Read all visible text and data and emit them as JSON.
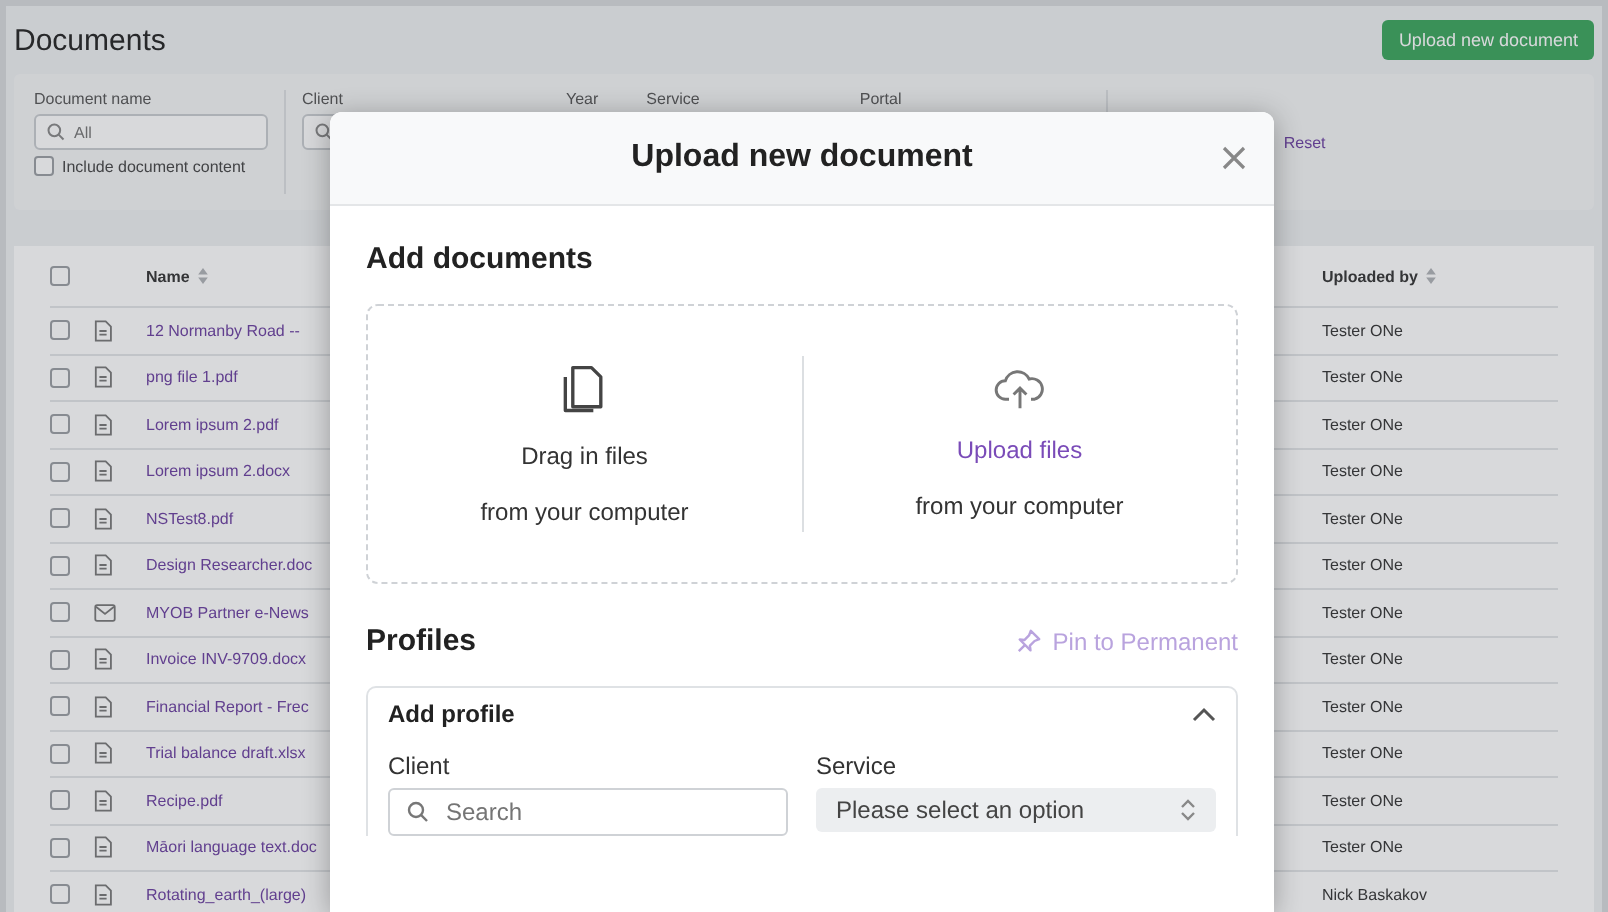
{
  "page": {
    "title": "Documents",
    "upload_button": "Upload new document"
  },
  "filters": {
    "document_name": {
      "label": "Document name",
      "placeholder": "All"
    },
    "include_content": {
      "label": "Include document content",
      "checked": false
    },
    "client": {
      "label": "Client"
    },
    "year": {
      "label": "Year"
    },
    "service": {
      "label": "Service"
    },
    "portal": {
      "label": "Portal"
    },
    "reset": "Reset"
  },
  "table": {
    "select_all_checked": false,
    "columns": [
      "Name",
      "Uploaded by"
    ],
    "rows": [
      {
        "kind": "file",
        "name": "12 Normanby Road --",
        "uploaded_by": "Tester ONe",
        "checked": false
      },
      {
        "kind": "file",
        "name": "png file 1.pdf",
        "uploaded_by": "Tester ONe",
        "checked": false
      },
      {
        "kind": "file",
        "name": "Lorem ipsum 2.pdf",
        "uploaded_by": "Tester ONe",
        "checked": false
      },
      {
        "kind": "file",
        "name": "Lorem ipsum 2.docx",
        "uploaded_by": "Tester ONe",
        "checked": false
      },
      {
        "kind": "file",
        "name": "NSTest8.pdf",
        "uploaded_by": "Tester ONe",
        "checked": false
      },
      {
        "kind": "file",
        "name": "Design Researcher.doc",
        "uploaded_by": "Tester ONe",
        "checked": false
      },
      {
        "kind": "email",
        "name": "MYOB Partner e-News",
        "uploaded_by": "Tester ONe",
        "checked": false
      },
      {
        "kind": "file",
        "name": "Invoice INV-9709.docx",
        "uploaded_by": "Tester ONe",
        "checked": false
      },
      {
        "kind": "file",
        "name": "Financial Report - Frec",
        "uploaded_by": "Tester ONe",
        "checked": false
      },
      {
        "kind": "file",
        "name": "Trial balance draft.xlsx",
        "uploaded_by": "Tester ONe",
        "checked": false
      },
      {
        "kind": "file",
        "name": "Recipe.pdf",
        "uploaded_by": "Tester ONe",
        "checked": false
      },
      {
        "kind": "file",
        "name": "Māori language text.doc",
        "uploaded_by": "Tester ONe",
        "checked": false
      },
      {
        "kind": "file",
        "name": "Rotating_earth_(large)",
        "uploaded_by": "Nick Baskakov",
        "checked": false
      }
    ]
  },
  "modal": {
    "title": "Upload new document",
    "section_title": "Add documents",
    "drop_options": [
      {
        "kind": "drag",
        "title": "Drag in files",
        "subtitle": "from your computer"
      },
      {
        "kind": "upload",
        "title": "Upload files",
        "subtitle": "from your computer"
      }
    ],
    "profiles_title": "Profiles",
    "pin_link": "Pin to Permanent",
    "add_profile": {
      "title": "Add profile",
      "expanded": true,
      "client": {
        "label": "Client",
        "placeholder": "Search"
      },
      "service": {
        "label": "Service",
        "placeholder": "Please select an option"
      }
    }
  }
}
